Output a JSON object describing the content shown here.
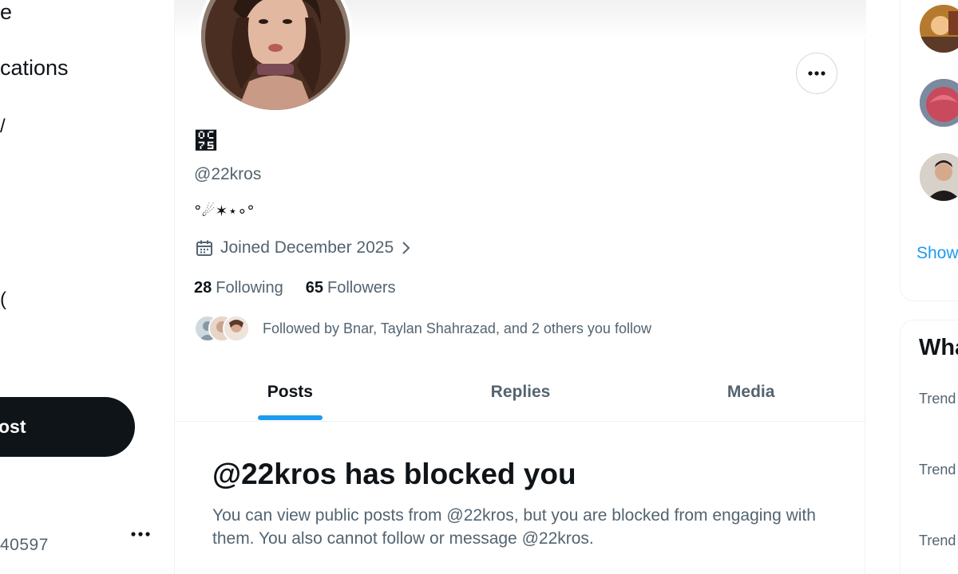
{
  "left_nav": {
    "items": [
      "e",
      "cations",
      "/",
      "("
    ],
    "post_button": "ost",
    "account_handle_fragment": "40597"
  },
  "profile": {
    "display_name": "౵",
    "handle": "@22kros",
    "bio": "°☄✶⋆∘°",
    "joined": "Joined December 2025",
    "following_count": "28",
    "following_label": "Following",
    "followers_count": "65",
    "followers_label": "Followers",
    "followed_by": "Followed by Bnar, Taylan Shahrazad, and 2 others you follow"
  },
  "tabs": [
    {
      "label": "Posts",
      "active": true
    },
    {
      "label": "Replies",
      "active": false
    },
    {
      "label": "Media",
      "active": false
    }
  ],
  "blocked": {
    "title": "@22kros has blocked you",
    "description": "You can view public posts from @22kros, but you are blocked from engaging with them. You also cannot follow or message @22kros."
  },
  "right_sidebar": {
    "show_more": "Show",
    "happening_title": "Wha",
    "trend_labels": [
      "Trend",
      "Trend",
      "Trend"
    ]
  },
  "colors": {
    "accent": "#1d9bf0",
    "text_primary": "#0f1419",
    "text_secondary": "#536471",
    "border": "#eff3f4"
  }
}
